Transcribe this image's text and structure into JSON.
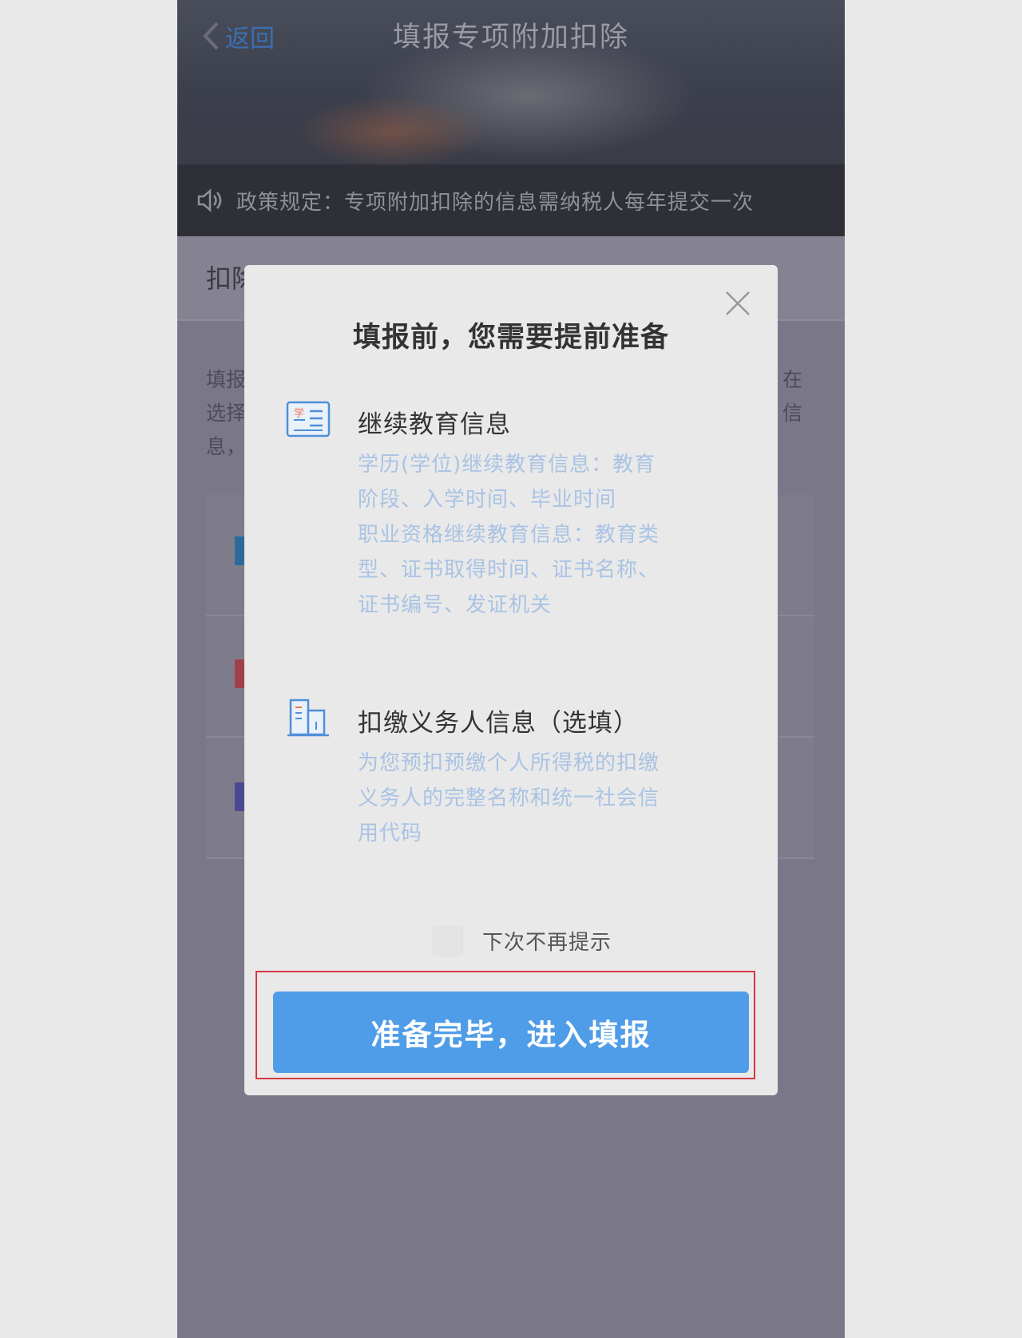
{
  "nav": {
    "back_label": "返回",
    "title": "填报专项附加扣除"
  },
  "notice": {
    "text": "政策规定：专项附加扣除的信息需纳税人每年提交一次"
  },
  "background": {
    "section_title": "扣除",
    "desc_left": [
      "填报",
      "选择",
      "息，"
    ],
    "desc_right": [
      "在",
      "信"
    ]
  },
  "dialog": {
    "title": "填报前，您需要提前准备",
    "items": [
      {
        "icon": "education-document-icon",
        "title": "继续教育信息",
        "desc": [
          "学历(学位)继续教育信息：教育",
          "阶段、入学时间、毕业时间",
          "职业资格继续教育信息：教育类",
          "型、证书取得时间、证书名称、",
          "证书编号、发证机关"
        ]
      },
      {
        "icon": "building-icon",
        "title": "扣缴义务人信息（选填）",
        "desc": [
          "为您预扣预缴个人所得税的扣缴",
          "义务人的完整名称和统一社会信",
          "用代码"
        ]
      }
    ],
    "checkbox_label": "下次不再提示",
    "confirm_button": "准备完毕，进入填报"
  },
  "colors": {
    "accent": "#4f9ce8",
    "highlight_border": "#d23a44"
  }
}
